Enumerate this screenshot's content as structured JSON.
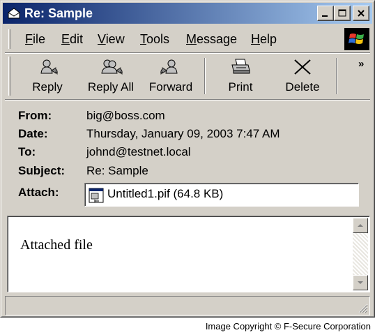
{
  "window": {
    "title": "Re: Sample",
    "title_icon": "envelope-icon",
    "buttons": {
      "minimize": "minimize-icon",
      "maximize": "maximize-icon",
      "close": "close-icon"
    }
  },
  "menu": {
    "items": [
      {
        "accel": "F",
        "rest": "ile"
      },
      {
        "accel": "E",
        "rest": "dit"
      },
      {
        "accel": "V",
        "rest": "iew"
      },
      {
        "accel": "T",
        "rest": "ools"
      },
      {
        "accel": "M",
        "rest": "essage"
      },
      {
        "accel": "H",
        "rest": "elp"
      }
    ]
  },
  "toolbar": {
    "reply": "Reply",
    "reply_all": "Reply All",
    "forward": "Forward",
    "print": "Print",
    "delete": "Delete",
    "more": "»"
  },
  "header": {
    "from_label": "From:",
    "from_value": "big@boss.com",
    "date_label": "Date:",
    "date_value": "Thursday, January 09, 2003 7:47 AM",
    "to_label": "To:",
    "to_value": "johnd@testnet.local",
    "subject_label": "Subject:",
    "subject_value": "Re: Sample",
    "attach_label": "Attach:",
    "attach_value": "Untitled1.pif (64.8 KB)"
  },
  "body": {
    "text": "Attached file"
  },
  "footer": {
    "copyright": "Image Copyright © F-Secure Corporation"
  },
  "colors": {
    "titlebar_start": "#0a246a",
    "titlebar_end": "#a6caf0",
    "face": "#d4d0c8"
  }
}
